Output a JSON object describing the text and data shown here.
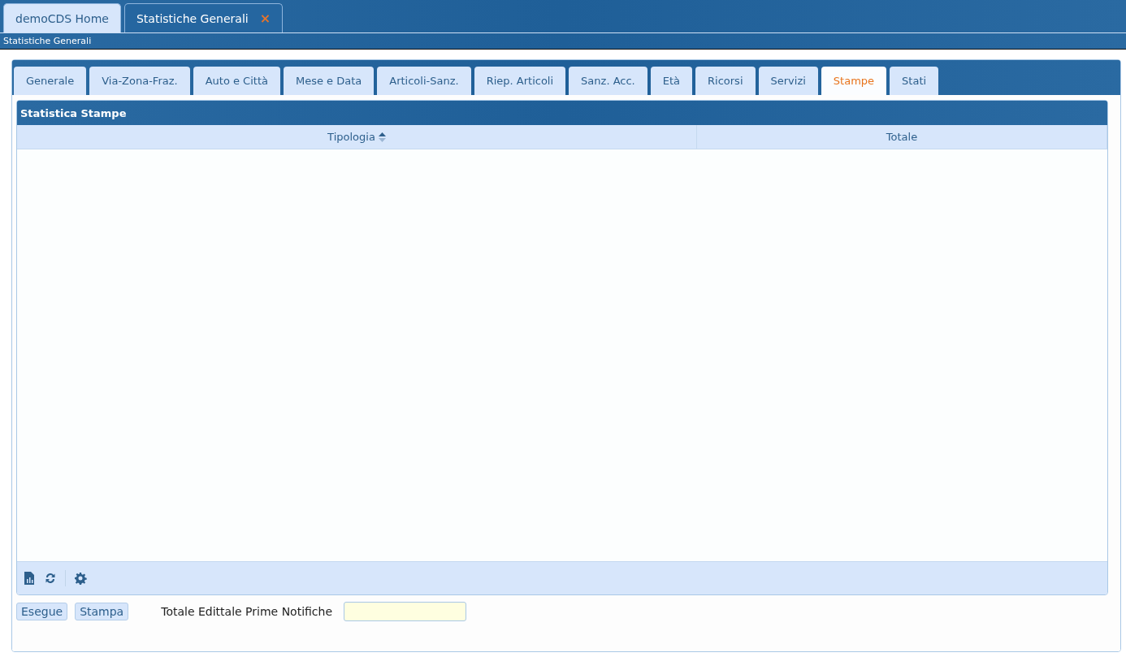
{
  "window_tabs": [
    {
      "label": "demoCDS Home",
      "selected": false,
      "closable": false
    },
    {
      "label": "Statistiche Generali",
      "selected": true,
      "closable": true,
      "close": "×"
    }
  ],
  "breadcrumb": "Statistiche Generali",
  "tabs": [
    {
      "label": "Generale",
      "selected": false
    },
    {
      "label": "Via-Zona-Fraz.",
      "selected": false
    },
    {
      "label": "Auto e Città",
      "selected": false
    },
    {
      "label": "Mese e Data",
      "selected": false
    },
    {
      "label": "Articoli-Sanz.",
      "selected": false
    },
    {
      "label": "Riep. Articoli",
      "selected": false
    },
    {
      "label": "Sanz. Acc.",
      "selected": false
    },
    {
      "label": "Età",
      "selected": false
    },
    {
      "label": "Ricorsi",
      "selected": false
    },
    {
      "label": "Servizi",
      "selected": false
    },
    {
      "label": "Stampe",
      "selected": true
    },
    {
      "label": "Stati",
      "selected": false
    }
  ],
  "grid": {
    "title": "Statistica Stampe",
    "columns": [
      {
        "label": "Tipologia",
        "sortable": true
      },
      {
        "label": "Totale",
        "sortable": false
      }
    ]
  },
  "buttons": [
    "Esegue",
    "Stampa"
  ],
  "total_field": {
    "label": "Totale Edittale Prime Notifiche"
  }
}
